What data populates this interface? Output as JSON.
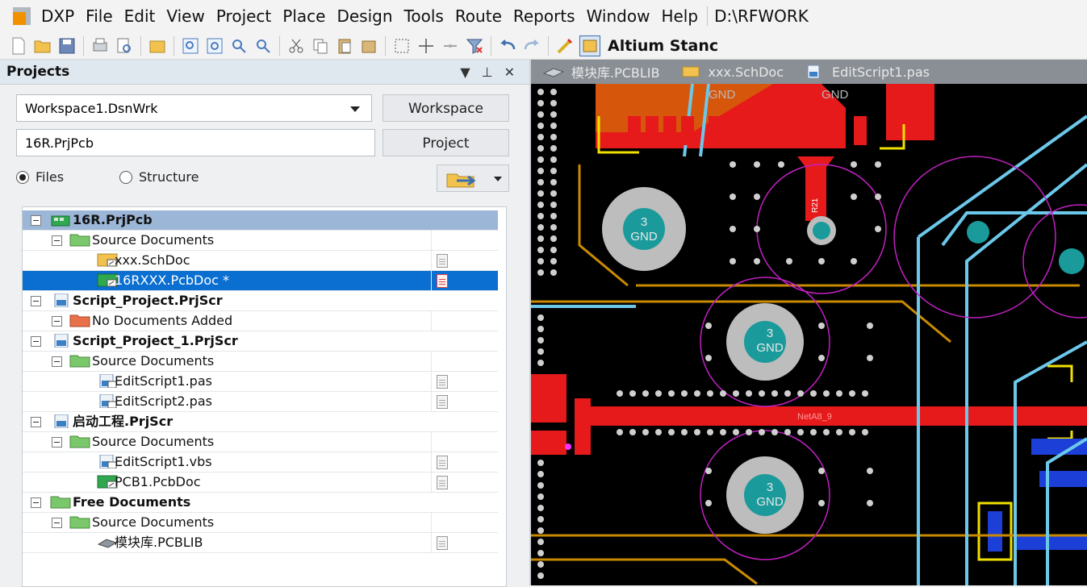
{
  "menubar": {
    "app": "DXP",
    "items": [
      "File",
      "Edit",
      "View",
      "Project",
      "Place",
      "Design",
      "Tools",
      "Route",
      "Reports",
      "Window",
      "Help"
    ],
    "path": "D:\\RFWORK"
  },
  "toolbar": {
    "standard_label": "Altium Stanc"
  },
  "panel": {
    "title": "Projects",
    "workspace_value": "Workspace1.DsnWrk",
    "workspace_button": "Workspace",
    "project_value": "16R.PrjPcb",
    "project_button": "Project",
    "radio_files": "Files",
    "radio_structure": "Structure",
    "radio_selected": "Files"
  },
  "tree": [
    {
      "label": "16R.PrjPcb",
      "bold": true,
      "level": 0,
      "icon": "pcb-project-icon"
    },
    {
      "label": "Source Documents",
      "level": 1,
      "icon": "folder-icon"
    },
    {
      "label": "xxx.SchDoc",
      "level": 2,
      "icon": "schematic-doc-icon"
    },
    {
      "label": "16RXXX.PcbDoc *",
      "level": 2,
      "icon": "pcb-doc-icon",
      "selected": true
    },
    {
      "label": "Script_Project.PrjScr",
      "bold": true,
      "level": 0,
      "icon": "script-project-icon"
    },
    {
      "label": "No Documents Added",
      "level": 1,
      "icon": "empty-folder-icon"
    },
    {
      "label": "Script_Project_1.PrjScr",
      "bold": true,
      "level": 0,
      "icon": "script-project-icon"
    },
    {
      "label": "Source Documents",
      "level": 1,
      "icon": "folder-icon"
    },
    {
      "label": "EditScript1.pas",
      "level": 2,
      "icon": "script-file-icon"
    },
    {
      "label": "EditScript2.pas",
      "level": 2,
      "icon": "script-file-icon"
    },
    {
      "label": "启动工程.PrjScr",
      "bold": true,
      "level": 0,
      "icon": "script-project-icon"
    },
    {
      "label": "Source Documents",
      "level": 1,
      "icon": "folder-icon"
    },
    {
      "label": "EditScript1.vbs",
      "level": 2,
      "icon": "script-file-icon"
    },
    {
      "label": "PCB1.PcbDoc",
      "level": 2,
      "icon": "pcb-doc-icon"
    },
    {
      "label": "Free Documents",
      "bold": true,
      "level": 0,
      "icon": "folder-icon"
    },
    {
      "label": "Source Documents",
      "level": 1,
      "icon": "folder-icon"
    },
    {
      "label": "模块库.PCBLIB",
      "level": 2,
      "icon": "pcb-library-icon"
    }
  ],
  "tabs": [
    {
      "label": "模块库.PCBLIB",
      "icon": "pcb-library-icon"
    },
    {
      "label": "xxx.SchDoc",
      "icon": "schematic-doc-icon"
    },
    {
      "label": "EditScript1.pas",
      "icon": "script-file-icon"
    }
  ],
  "pcb": {
    "gnd_label": "GND",
    "pad_number": "3",
    "net_label": "NetA8_9",
    "ref_label": "R21"
  }
}
